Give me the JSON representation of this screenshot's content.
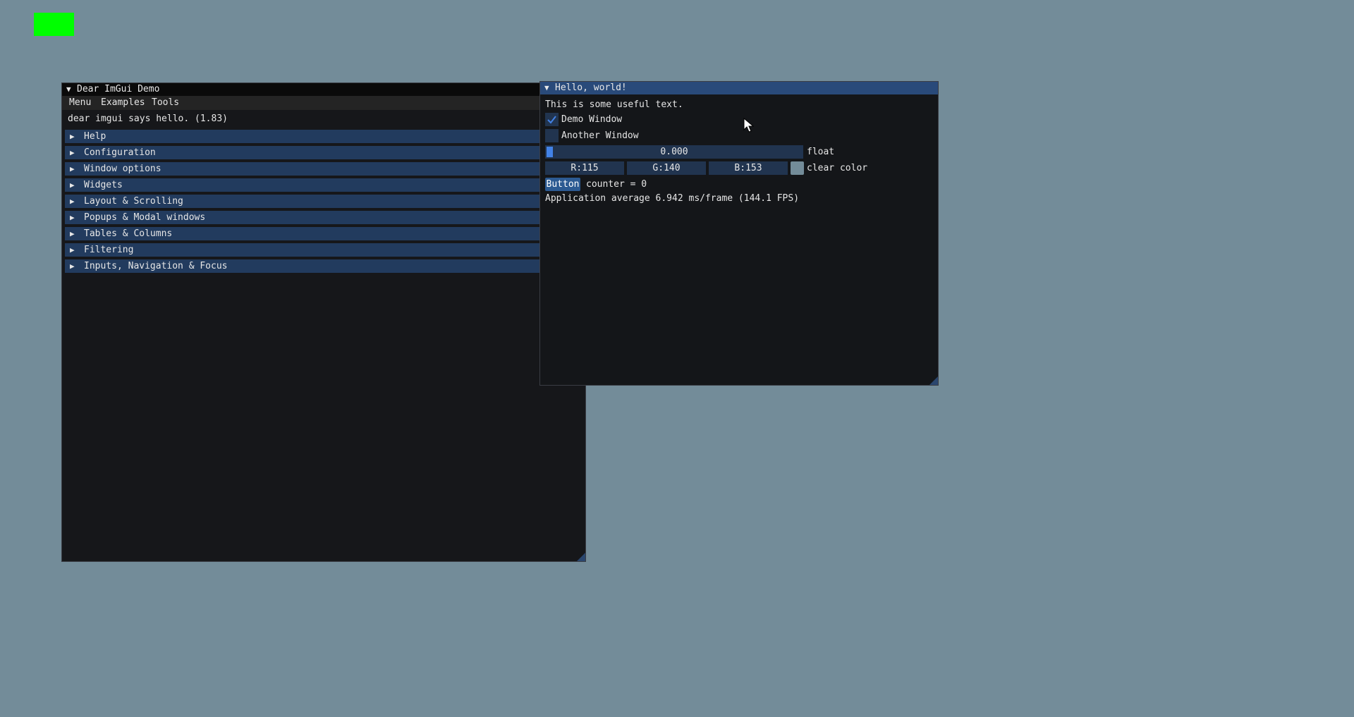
{
  "demo_window": {
    "title": "Dear ImGui Demo",
    "menu": [
      "Menu",
      "Examples",
      "Tools"
    ],
    "intro_text": "dear imgui says hello. (1.83)",
    "sections": [
      "Help",
      "Configuration",
      "Window options",
      "Widgets",
      "Layout & Scrolling",
      "Popups & Modal windows",
      "Tables & Columns",
      "Filtering",
      "Inputs, Navigation & Focus"
    ]
  },
  "hello_window": {
    "title": "Hello, world!",
    "useful_text": "This is some useful text.",
    "checkbox_demo": {
      "label": "Demo Window",
      "checked": true
    },
    "checkbox_another": {
      "label": "Another Window",
      "checked": false
    },
    "slider": {
      "value_text": "0.000",
      "label": "float",
      "fraction": 0.0
    },
    "color": {
      "r": "R:115",
      "g": "G:140",
      "b": "B:153",
      "label": "clear color",
      "swatch": "#738c99"
    },
    "button_label": "Button",
    "counter_text": "counter = 0",
    "fps_text": "Application average 6.942 ms/frame (144.1 FPS)"
  },
  "colors": {
    "background": "#738c99",
    "window_bg": "#16171a",
    "title_active": "#294a7a",
    "header": "#223b5e",
    "accent": "#4282e6",
    "indicator": "#00ff00"
  },
  "icons": {
    "collapse": "triangle-down-icon",
    "tree_node": "triangle-right-icon",
    "check": "checkmark-icon",
    "cursor": "mouse-cursor-icon"
  }
}
